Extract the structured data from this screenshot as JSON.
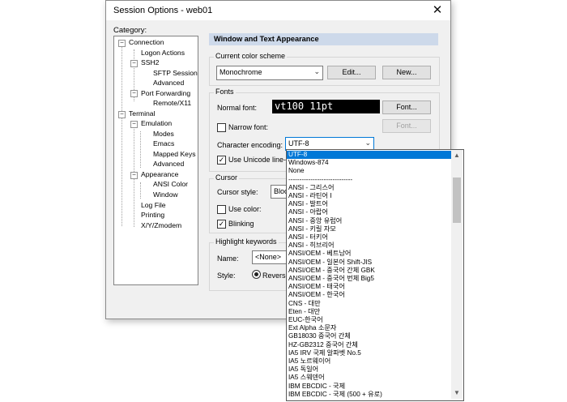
{
  "window": {
    "title": "Session Options - web01",
    "close_glyph": "✕"
  },
  "category": {
    "label": "Category:",
    "tree": [
      {
        "label": "Connection",
        "toggle": "−"
      },
      {
        "label": "Logon Actions"
      },
      {
        "label": "SSH2",
        "toggle": "−"
      },
      {
        "label": "SFTP Session"
      },
      {
        "label": "Advanced"
      },
      {
        "label": "Port Forwarding",
        "toggle": "−"
      },
      {
        "label": "Remote/X11"
      },
      {
        "label": "Terminal",
        "toggle": "−"
      },
      {
        "label": "Emulation",
        "toggle": "−"
      },
      {
        "label": "Modes"
      },
      {
        "label": "Emacs"
      },
      {
        "label": "Mapped Keys"
      },
      {
        "label": "Advanced"
      },
      {
        "label": "Appearance",
        "toggle": "−"
      },
      {
        "label": "ANSI Color"
      },
      {
        "label": "Window"
      },
      {
        "label": "Log File"
      },
      {
        "label": "Printing"
      },
      {
        "label": "X/Y/Zmodem"
      }
    ]
  },
  "panel": {
    "header": "Window and Text Appearance",
    "color_scheme": {
      "group": "Current color scheme",
      "value": "Monochrome",
      "edit": "Edit...",
      "new": "New..."
    },
    "fonts": {
      "group": "Fonts",
      "normal_label": "Normal font:",
      "normal_preview": "vt100 11pt",
      "font_button": "Font...",
      "narrow_label": "Narrow font:",
      "narrow_button": "Font...",
      "encoding_label": "Character encoding:",
      "encoding_value": "UTF-8",
      "unicode_label": "Use Unicode line-dr"
    },
    "cursor": {
      "group": "Cursor",
      "style_label": "Cursor style:",
      "style_value": "Bloc",
      "use_color": "Use color:",
      "blinking": "Blinking"
    },
    "highlight": {
      "group": "Highlight keywords",
      "name_label": "Name:",
      "name_value": "<None>",
      "style_label": "Style:",
      "style_value": "Reverse"
    }
  },
  "encoding_list": [
    "UTF-8",
    "Windows-874",
    "None",
    "-----------------------------",
    "ANSI - 그리스어",
    "ANSI - 라틴어 I",
    "ANSI - 발트어",
    "ANSI - 아랍어",
    "ANSI - 중앙 유럽어",
    "ANSI - 키릴 자모",
    "ANSI - 터키어",
    "ANSI - 히브리어",
    "ANSI/OEM - 베트남어",
    "ANSI/OEM - 일본어 Shift-JIS",
    "ANSI/OEM - 중국어 간체 GBK",
    "ANSI/OEM - 중국어 번체 Big5",
    "ANSI/OEM - 태국어",
    "ANSI/OEM - 한국어",
    "CNS - 대만",
    "Eten - 대만",
    "EUC-한국어",
    "Ext Alpha 소문자",
    "GB18030 중국어 간체",
    "HZ-GB2312 중국어 간체",
    "IA5 IRV 국제 알파벳 No.5",
    "IA5 노르웨이어",
    "IA5 독일어",
    "IA5 스웨덴어",
    "IBM EBCDIC - 국제",
    "IBM EBCDIC - 국제 (500 + 유로)"
  ]
}
